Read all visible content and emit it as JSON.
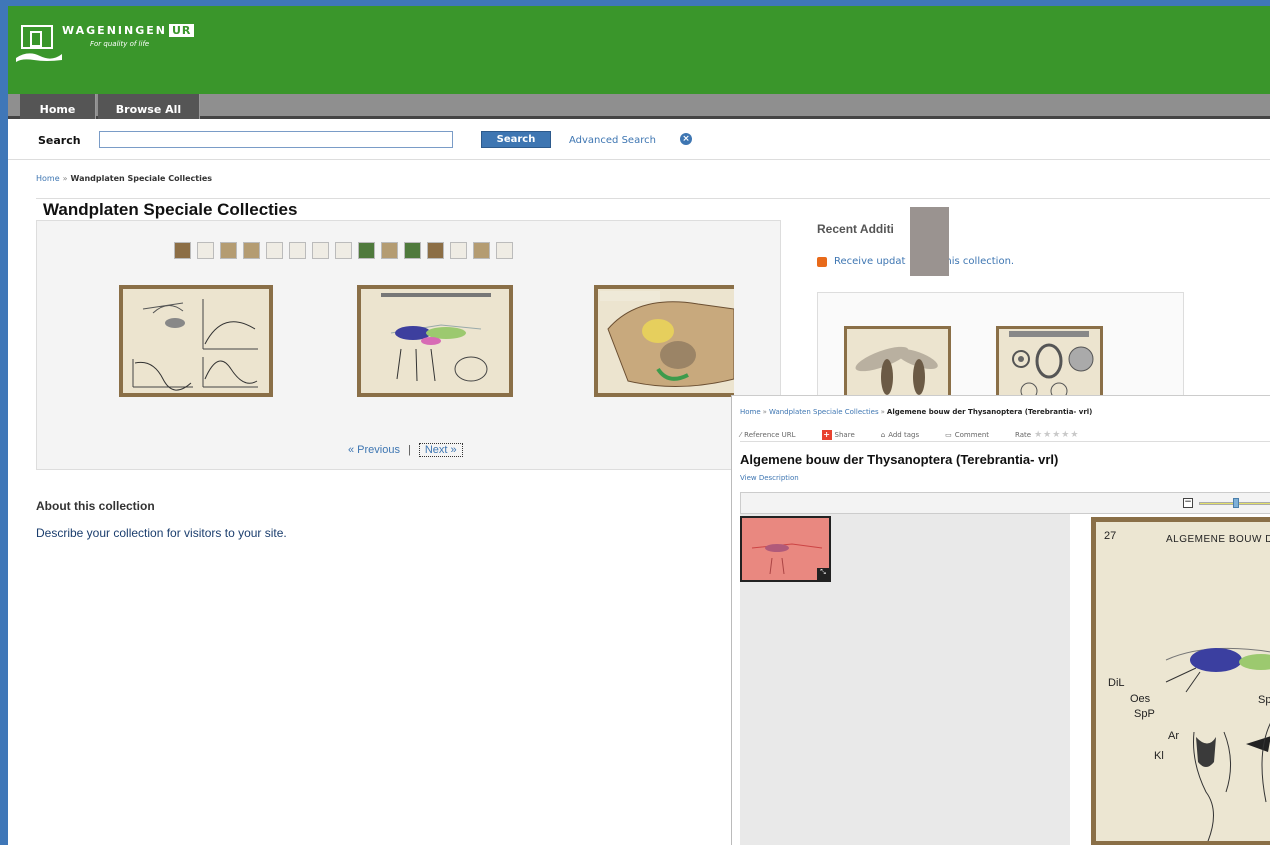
{
  "brand": {
    "name": "WAGENINGEN",
    "badge": "UR",
    "slogan": "For quality of life"
  },
  "nav": {
    "tabs": [
      {
        "label": "Home"
      },
      {
        "label": "Browse All"
      }
    ]
  },
  "search": {
    "label": "Search",
    "button_label": "Search",
    "advanced_label": "Advanced Search",
    "value": ""
  },
  "breadcrumb": {
    "home": "Home",
    "separator": "»",
    "current": "Wandplaten Speciale Collecties"
  },
  "collection": {
    "title": "Wandplaten Speciale Collecties",
    "thumbnail_count": 15
  },
  "pager": {
    "previous_label": "« Previous",
    "separator": "|",
    "next_label": "Next »"
  },
  "about": {
    "heading": "About this collection",
    "text": "Describe your collection for visitors to your site."
  },
  "recent": {
    "heading": "Recent Additi",
    "rss_part1": "Receive updat",
    "rss_part2": "his collection."
  },
  "detail": {
    "breadcrumb_home": "Home",
    "breadcrumb_collection": "Wandplaten Speciale Collecties",
    "breadcrumb_current": "Algemene bouw der Thysanoptera (Terebrantia- vrl)",
    "toolbar": {
      "reference_url": "Reference URL",
      "share": "Share",
      "add_tags": "Add tags",
      "comment": "Comment",
      "rate": "Rate"
    },
    "title": "Algemene bouw der Thysanoptera (Terebrantia- vrl)",
    "view_description": "View Description",
    "plate": {
      "number": "27",
      "heading": "ALGEMENE BOUW DE",
      "labels": [
        "DiL",
        "Oes",
        "SpP",
        "SpK",
        "Ar",
        "Kl"
      ]
    }
  },
  "colors": {
    "header_green": "#3a962b",
    "link_blue": "#3e76b2",
    "desktop_blue": "#3f77b8"
  }
}
